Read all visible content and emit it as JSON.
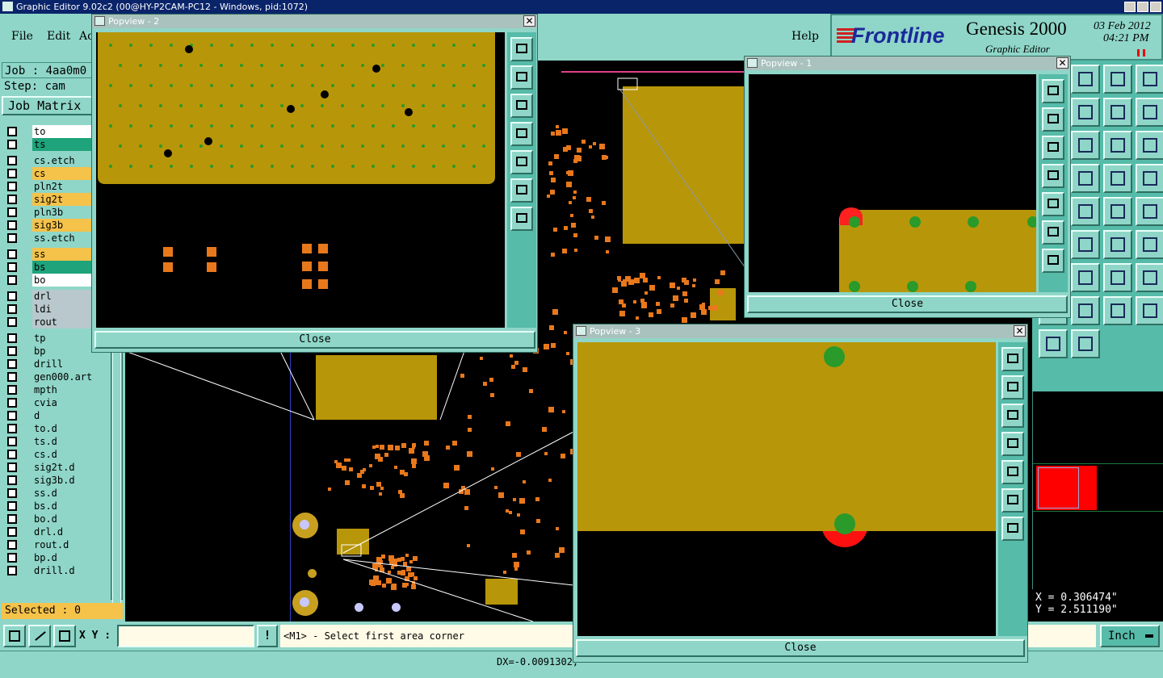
{
  "window_title": "Graphic Editor 9.02c2 (00@HY-P2CAM-PC12 - Windows, pid:1072)",
  "menu": {
    "file": "File",
    "edit": "Edit",
    "action_partial": "Ac",
    "help": "Help"
  },
  "brand": {
    "logo": "Frontline",
    "product": "Genesis 2000",
    "subtitle": "Graphic Editor",
    "date": "03 Feb 2012",
    "time": "04:21 PM"
  },
  "job": {
    "job_label": "Job : 4aa0m0",
    "step_label": "Step: cam",
    "matrix_button": "Job Matrix"
  },
  "layers": [
    {
      "name": "to",
      "color": "#ffffff"
    },
    {
      "name": "ts",
      "color": "#1fa37a"
    },
    {
      "name": "cs.etch",
      "color": "#8fd6c8"
    },
    {
      "name": "cs",
      "color": "#f5c24a"
    },
    {
      "name": "pln2t",
      "color": "#8fd6c8"
    },
    {
      "name": "sig2t",
      "color": "#f5c24a"
    },
    {
      "name": "pln3b",
      "color": "#8fd6c8"
    },
    {
      "name": "sig3b",
      "color": "#f5c24a"
    },
    {
      "name": "ss.etch",
      "color": "#8fd6c8"
    },
    {
      "name": "ss",
      "color": "#f5c24a"
    },
    {
      "name": "bs",
      "color": "#1fa37a"
    },
    {
      "name": "bo",
      "color": "#ffffff"
    },
    {
      "name": "drl",
      "color": "#b8c8cc"
    },
    {
      "name": "ldi",
      "color": "#b8c8cc"
    },
    {
      "name": "rout",
      "color": "#b8c8cc"
    },
    {
      "name": "tp",
      "color": "#8fd6c8"
    },
    {
      "name": "bp",
      "color": "#8fd6c8"
    },
    {
      "name": "drill",
      "color": "#8fd6c8"
    },
    {
      "name": "gen000.art",
      "color": "#8fd6c8"
    },
    {
      "name": "mpth",
      "color": "#8fd6c8"
    },
    {
      "name": "cvia",
      "color": "#8fd6c8"
    },
    {
      "name": "d",
      "color": "#8fd6c8"
    },
    {
      "name": "to.d",
      "color": "#8fd6c8"
    },
    {
      "name": "ts.d",
      "color": "#8fd6c8"
    },
    {
      "name": "cs.d",
      "color": "#8fd6c8"
    },
    {
      "name": "sig2t.d",
      "color": "#8fd6c8"
    },
    {
      "name": "sig3b.d",
      "color": "#8fd6c8"
    },
    {
      "name": "ss.d",
      "color": "#8fd6c8"
    },
    {
      "name": "bs.d",
      "color": "#8fd6c8"
    },
    {
      "name": "bo.d",
      "color": "#8fd6c8"
    },
    {
      "name": "drl.d",
      "color": "#8fd6c8"
    },
    {
      "name": "rout.d",
      "color": "#8fd6c8"
    },
    {
      "name": "bp.d",
      "color": "#8fd6c8"
    },
    {
      "name": "drill.d",
      "color": "#8fd6c8"
    }
  ],
  "status": {
    "selected": "Selected : 0",
    "xy_label": "X Y :",
    "xy_value": "",
    "prompt": "<M1> - Select first area corner",
    "units": "Inch",
    "coord_x": "X = 0.306474\"",
    "coord_y": "Y = 2.511190\"",
    "bottom_readout": "DX=-0.0091302,"
  },
  "popviews": {
    "p1": {
      "title": "Popview - 1",
      "close": "Close"
    },
    "p2": {
      "title": "Popview - 2",
      "close": "Close"
    },
    "p3": {
      "title": "Popview - 3",
      "close": "Close"
    }
  },
  "colors": {
    "board": "#b8960a",
    "teal": "#8fd6c8",
    "via": "#2a9a2a",
    "pad": "#e8781c",
    "highlight": "#ff0000"
  }
}
